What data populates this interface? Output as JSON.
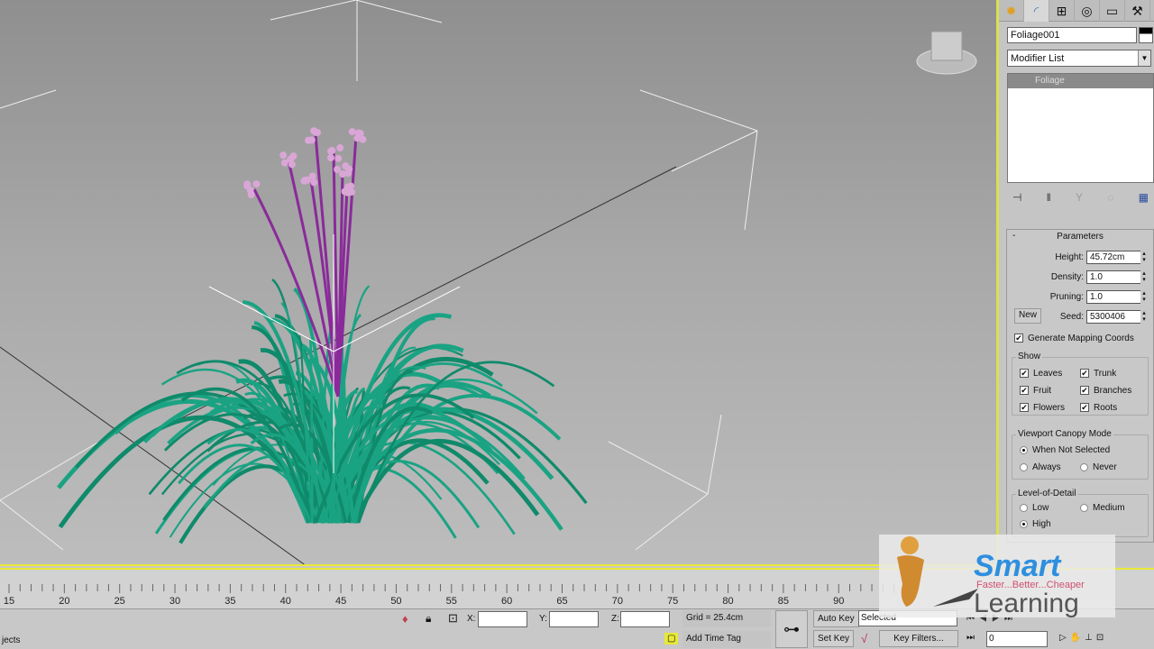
{
  "command_panel": {
    "tabs": [
      "create-icon",
      "modify-icon",
      "hierarchy-icon",
      "motion-icon",
      "display-icon",
      "utilities-icon"
    ],
    "object_name": "Foliage001",
    "modifier_list": "Modifier List",
    "stack": [
      "Foliage"
    ],
    "parameters": {
      "title": "Parameters",
      "height_label": "Height:",
      "height": "45.72cm",
      "density_label": "Density:",
      "density": "1.0",
      "pruning_label": "Pruning:",
      "pruning": "1.0",
      "new_label": "New",
      "seed_label": "Seed:",
      "seed": "5300406",
      "gen_mapping": "Generate Mapping Coords",
      "show_title": "Show",
      "show": [
        {
          "label": "Leaves",
          "checked": true
        },
        {
          "label": "Trunk",
          "checked": true
        },
        {
          "label": "Fruit",
          "checked": true
        },
        {
          "label": "Branches",
          "checked": true
        },
        {
          "label": "Flowers",
          "checked": true
        },
        {
          "label": "Roots",
          "checked": true
        }
      ],
      "canopy_title": "Viewport Canopy Mode",
      "canopy": [
        "When Not Selected",
        "Always",
        "Never"
      ],
      "canopy_selected": "When Not Selected",
      "lod_title": "Level-of-Detail",
      "lod": [
        "Low",
        "Medium",
        "High"
      ],
      "lod_selected": "High"
    }
  },
  "timeline": {
    "ticks": [
      "15",
      "20",
      "25",
      "30",
      "35",
      "40",
      "45",
      "50",
      "55",
      "60",
      "65",
      "70",
      "75",
      "80",
      "85",
      "90"
    ]
  },
  "status": {
    "prompt": "jects",
    "x_label": "X:",
    "y_label": "Y:",
    "z_label": "Z:",
    "grid": "Grid = 25.4cm",
    "add_time_tag": "Add Time Tag",
    "auto_key": "Auto Key",
    "set_key": "Set Key",
    "selected": "Selected",
    "key_filters": "Key Filters...",
    "frame": "0"
  },
  "logo": {
    "name": "Smart",
    "tagline": "Faster...Better...Cheaper",
    "name2": "Learning"
  },
  "colors": {
    "leaf": "#1aa383",
    "stem": "#8a2a9a",
    "flower": "#d9a6d6",
    "selection": "#e8e838"
  }
}
